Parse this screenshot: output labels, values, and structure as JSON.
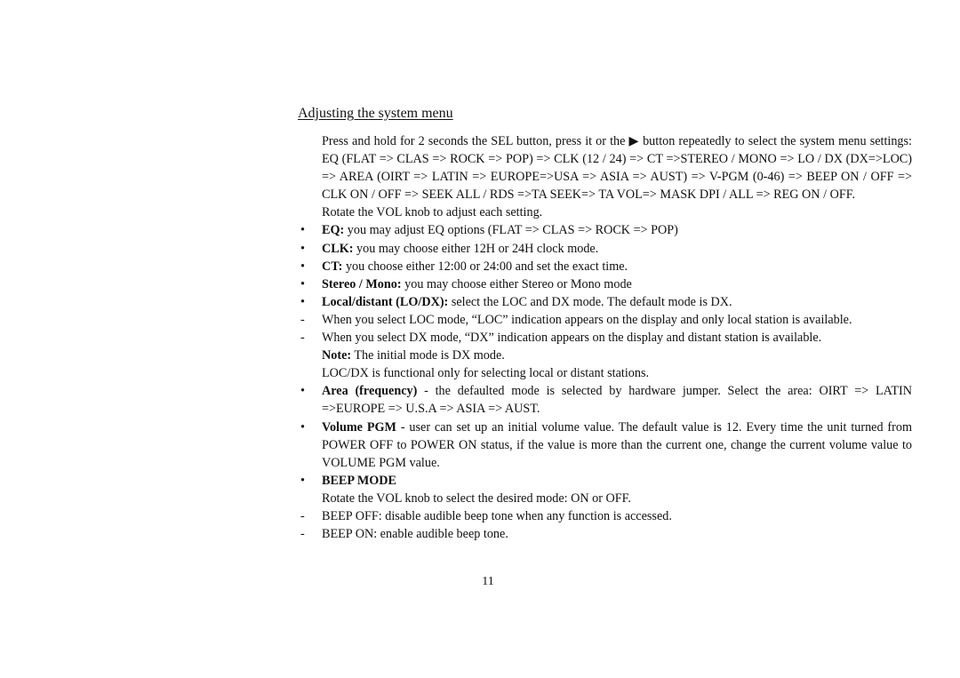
{
  "page": {
    "title": "Adjusting the system menu",
    "page_number": "11"
  },
  "content": {
    "intro": "Press and hold for 2 seconds the SEL button, press it or the ▶ button repeatedly to select the system menu settings: EQ (FLAT => CLAS => ROCK => POP) => CLK (12 / 24) => CT =>STEREO / MONO => LO / DX (DX=>LOC) => AREA (OIRT => LATIN => EUROPE=>USA => ASIA => AUST) => V-PGM (0-46) => BEEP ON / OFF => CLK ON / OFF => SEEK ALL / RDS =>TA SEEK=> TA VOL=> MASK DPI / ALL => REG ON / OFF.",
    "rotate": "Rotate the VOL knob to adjust each setting.",
    "items": [
      {
        "marker": "•",
        "bold": "EQ:",
        "text": " you may adjust EQ options (FLAT => CLAS => ROCK => POP)"
      },
      {
        "marker": "•",
        "bold": "CLK:",
        "text": " you may choose either 12H or 24H clock mode."
      },
      {
        "marker": "•",
        "bold": "CT:",
        "text": " you choose either 12:00 or 24:00 and set the exact time."
      },
      {
        "marker": "•",
        "bold": "Stereo / Mono:",
        "text": " you may choose either Stereo or Mono mode"
      },
      {
        "marker": "•",
        "bold": "Local/distant (LO/DX):",
        "text": " select the LOC and DX mode. The default mode is DX."
      },
      {
        "marker": "-",
        "bold": "",
        "text": "When you select LOC mode, “LOC” indication appears on the display and only local station is available."
      },
      {
        "marker": "-",
        "bold": "",
        "text": "When you select DX mode, “DX” indication appears on the display and distant station is available."
      },
      {
        "marker": "",
        "bold": "Note:",
        "text": " The initial mode is DX mode."
      },
      {
        "marker": "",
        "bold": "",
        "text": "LOC/DX is functional only for selecting local or distant stations."
      },
      {
        "marker": "•",
        "bold": "Area (frequency)",
        "text": " - the defaulted mode is selected by hardware jumper. Select the area: OIRT => LATIN =>EUROPE => U.S.A => ASIA => AUST."
      },
      {
        "marker": "•",
        "bold": "Volume PGM",
        "text": " - user can set up an initial volume value. The default value is 12. Every time the unit turned from POWER OFF to POWER ON status, if the value is more than the current one, change the current volume value to VOLUME PGM value."
      },
      {
        "marker": "•",
        "bold": "BEEP MODE",
        "text": ""
      },
      {
        "marker": "",
        "bold": "",
        "text": "Rotate the VOL knob to select the desired mode: ON or OFF."
      },
      {
        "marker": "-",
        "bold": "",
        "text": "BEEP OFF: disable audible beep tone when any function is accessed."
      },
      {
        "marker": "-",
        "bold": "",
        "text": "BEEP ON: enable audible beep tone."
      }
    ]
  }
}
